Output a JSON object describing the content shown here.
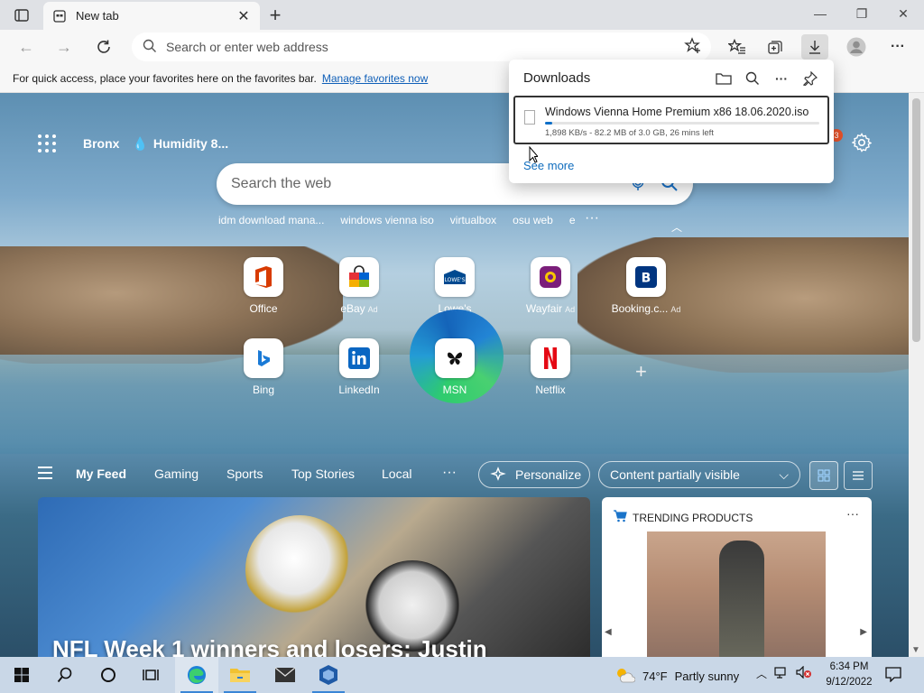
{
  "browser": {
    "tab_title": "New tab",
    "address_placeholder": "Search or enter web address",
    "favorites_message": "For quick access, place your favorites here on the favorites bar.",
    "manage_favorites": "Manage favorites now"
  },
  "newtab": {
    "location": "Bronx",
    "weather": "Humidity 8...",
    "notification_count": "3",
    "search_placeholder": "Search the web",
    "suggestions": [
      "idm download mana...",
      "windows vienna iso",
      "virtualbox",
      "osu web",
      "e"
    ],
    "tiles": [
      {
        "label": "Office",
        "ad": ""
      },
      {
        "label": "eBay",
        "ad": "Ad"
      },
      {
        "label": "Lowe's",
        "ad": ""
      },
      {
        "label": "Wayfair",
        "ad": "Ad"
      },
      {
        "label": "Booking.c...",
        "ad": "Ad"
      },
      {
        "label": "Bing",
        "ad": ""
      },
      {
        "label": "LinkedIn",
        "ad": ""
      },
      {
        "label": "MSN",
        "ad": ""
      },
      {
        "label": "Netflix",
        "ad": ""
      }
    ],
    "feed": {
      "tabs": [
        "My Feed",
        "Gaming",
        "Sports",
        "Top Stories",
        "Local"
      ],
      "personalize": "Personalize",
      "content_select": "Content partially visible"
    },
    "news_headline": "NFL Week 1 winners and losers: Justin",
    "trending_title": "TRENDING PRODUCTS"
  },
  "downloads": {
    "title": "Downloads",
    "file_name": "Windows Vienna Home Premium x86 18.06.2020.iso",
    "status": "1,898 KB/s - 82.2 MB of 3.0 GB, 26 mins left",
    "progress_fraction": 0.027,
    "see_more": "See more"
  },
  "taskbar": {
    "temperature": "74°F",
    "condition": "Partly sunny",
    "time": "6:34 PM",
    "date": "9/12/2022"
  },
  "colors": {
    "accent": "#0f6cbd",
    "taskbar": "#c9d7e7"
  }
}
